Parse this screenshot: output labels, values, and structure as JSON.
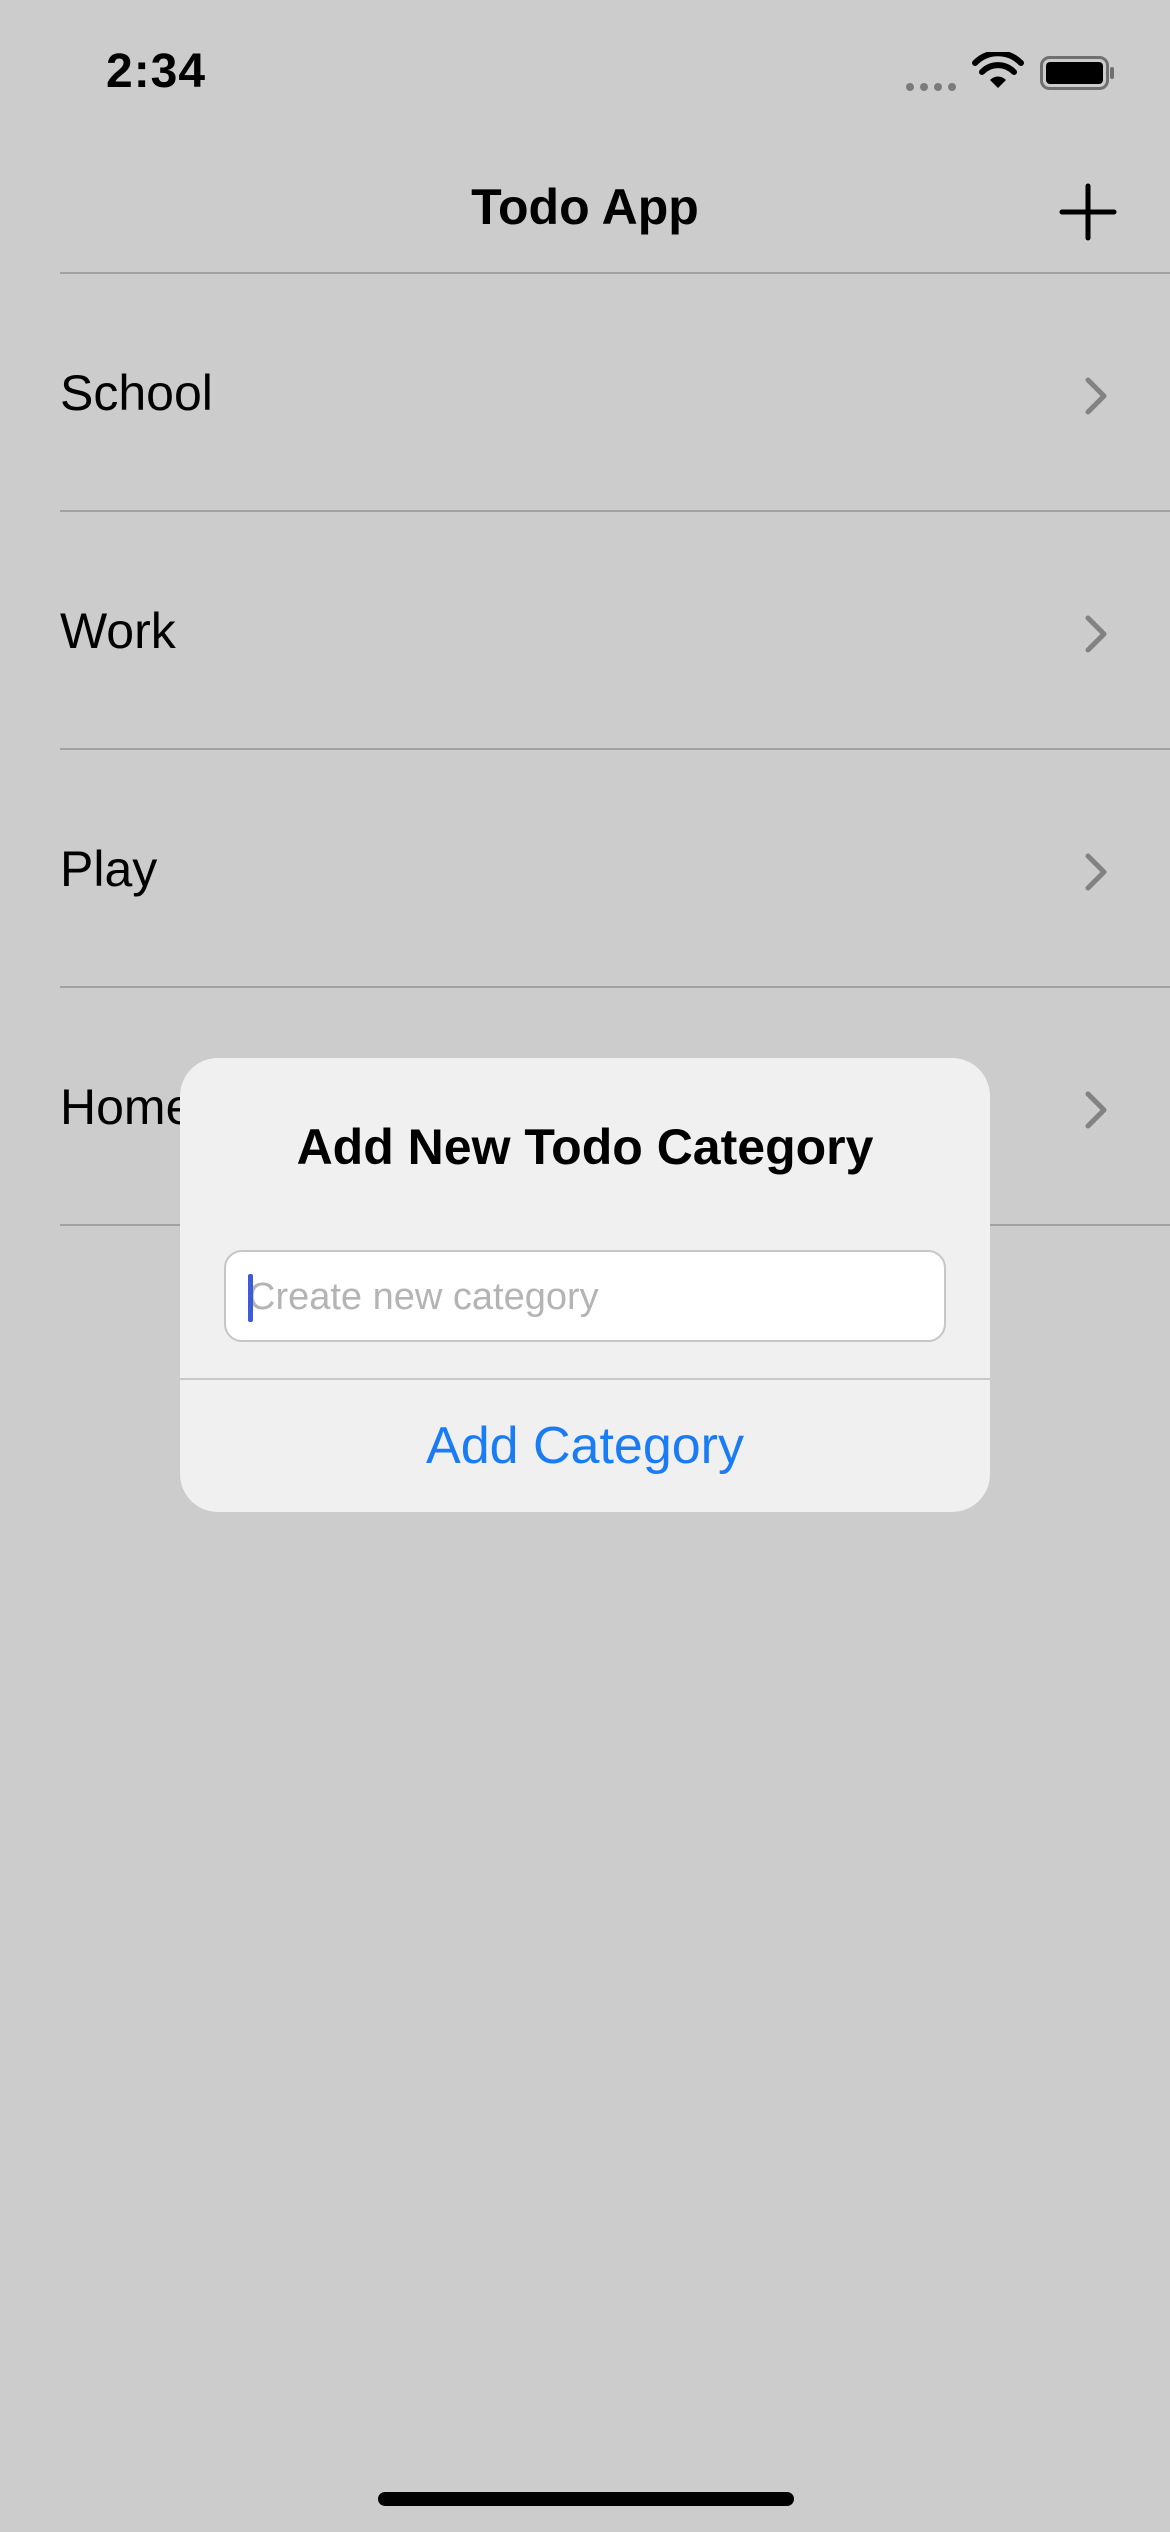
{
  "status_bar": {
    "time": "2:34",
    "icons": [
      "cellular-signal-icon",
      "wifi-icon",
      "battery-icon"
    ]
  },
  "nav": {
    "title": "Todo App",
    "add_icon": "plus-icon"
  },
  "categories": [
    {
      "label": "School"
    },
    {
      "label": "Work"
    },
    {
      "label": "Play"
    },
    {
      "label": "Home"
    }
  ],
  "alert": {
    "title": "Add New Todo Category",
    "input_value": "",
    "input_placeholder": "Create new category",
    "action_label": "Add Category"
  },
  "colors": {
    "accent": "#1a7cf4",
    "caret": "#3b5bdb",
    "separator": "#c8c8c8",
    "alert_background": "#f0f0f0"
  }
}
